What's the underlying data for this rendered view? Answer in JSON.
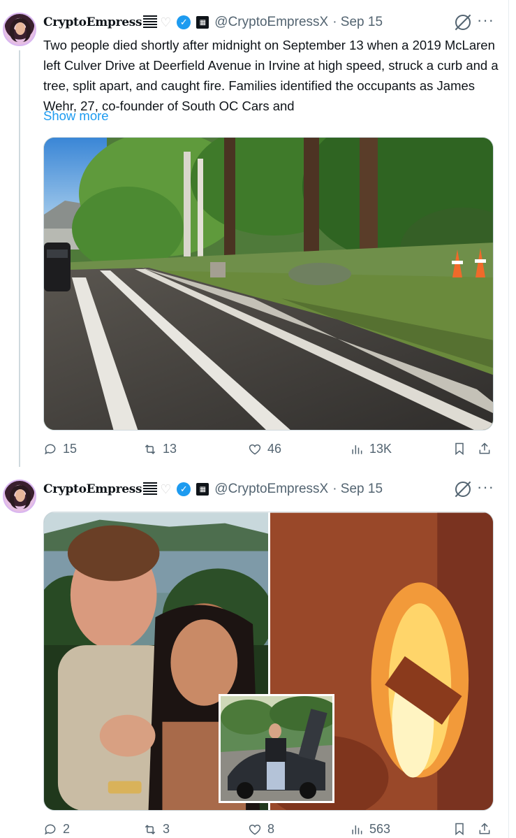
{
  "tweets": [
    {
      "display_name": "CryptoEmpress",
      "handle": "@CryptoEmpressX",
      "date": "· Sep 15",
      "text": "Two people died shortly after midnight on September 13 when a 2019 McLaren left Culver Drive at Deerfield Avenue in Irvine at high speed, struck a curb and a tree, split apart, and caught fire. Families identified the occupants as James Wehr, 27, co-founder of South OC Cars and",
      "show_more": "Show more",
      "replies": "15",
      "reposts": "13",
      "likes": "46",
      "views": "13K"
    },
    {
      "display_name": "CryptoEmpress",
      "handle": "@CryptoEmpressX",
      "date": "· Sep 15",
      "replies": "2",
      "reposts": "3",
      "likes": "8",
      "views": "563"
    }
  ],
  "icons": {
    "verified": "verified-badge-icon",
    "grok": "grok-icon",
    "more": "more-icon",
    "reply": "reply-icon",
    "repost": "repost-icon",
    "like": "like-icon",
    "views": "views-icon",
    "bookmark": "bookmark-icon",
    "share": "share-icon"
  },
  "colors": {
    "accent": "#1d9bf0",
    "secondary_text": "#536471",
    "primary_text": "#0f1419"
  }
}
